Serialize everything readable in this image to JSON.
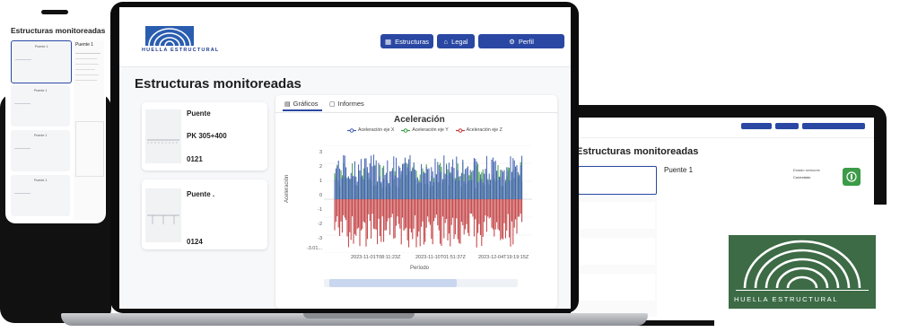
{
  "brand": {
    "name": "HUELLA ESTRUCTURAL"
  },
  "nav": {
    "estructuras": "Estructuras",
    "legal": "Legal",
    "perfil": "Perfil"
  },
  "page": {
    "title": "Estructuras monitoreadas"
  },
  "cards": [
    {
      "name": "Puente",
      "pk": "PK 305+400",
      "id": "0121"
    },
    {
      "name": "Puente .",
      "id": "0124"
    }
  ],
  "tabs": {
    "graficos": "Gráficos",
    "informes": "Informes"
  },
  "chart_data": {
    "type": "line",
    "title": "Aceleración",
    "series": [
      {
        "name": "Aceleración eje X",
        "color": "#3f5fb0"
      },
      {
        "name": "Aceleración eje Y",
        "color": "#3c9a48"
      },
      {
        "name": "Aceleración eje Z",
        "color": "#c0393b"
      }
    ],
    "ylabel": "Aceleración",
    "xlabel": "Período",
    "yticks": [
      "3",
      "2",
      "1",
      "0",
      "-1",
      "-2",
      "-3",
      "-3.01..."
    ],
    "xticks": [
      "2023-11-01T08:11:23Z",
      "2023-11-10T01:51:37Z",
      "2023-12-04T19:19:15Z"
    ],
    "ylim": [
      -3,
      3
    ]
  },
  "phone": {
    "title": "Estructuras monitoreadas",
    "detail_title": "Puente 1",
    "cards": [
      "Puente 1",
      "Puente 1",
      "Puente 1",
      "Puente 1"
    ]
  },
  "tablet": {
    "title": "Estructuras monitoreadas",
    "detail_title": "Puente 1",
    "estado_label": "Estado sensores",
    "estado_value": "Conectado"
  },
  "colors": {
    "primary": "#2a48a3",
    "logo_green": "#3c6b45",
    "x": "#3f5fb0",
    "y": "#3c9a48",
    "z": "#c0393b"
  }
}
